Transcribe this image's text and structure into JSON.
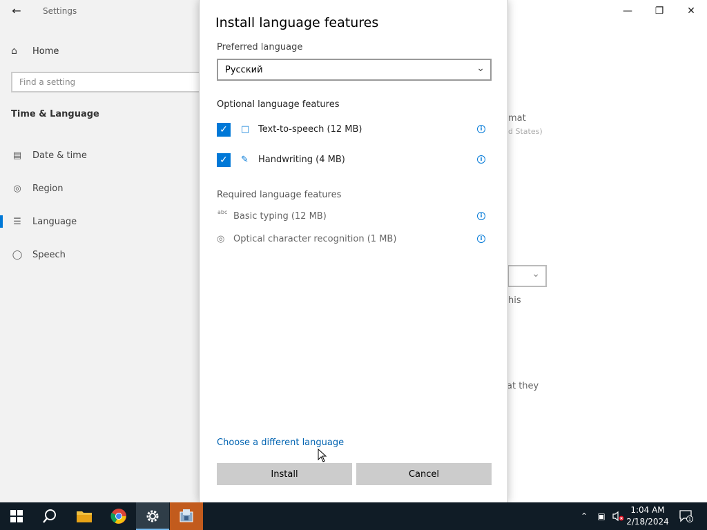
{
  "settings": {
    "app_title": "Settings",
    "home_label": "Home",
    "search_placeholder": "Find a setting",
    "section_title": "Time & Language",
    "nav": [
      {
        "label": "Date & time"
      },
      {
        "label": "Region"
      },
      {
        "label": "Language"
      },
      {
        "label": "Speech"
      }
    ],
    "background_fragments": {
      "format": "mat",
      "region": "d States)",
      "this": "his",
      "they": "at they"
    }
  },
  "dialog": {
    "title": "Install language features",
    "preferred_label": "Preferred language",
    "preferred_value": "Русский",
    "optional_label": "Optional language features",
    "optional_features": [
      {
        "label": "Text-to-speech (12 MB)",
        "checked": true
      },
      {
        "label": "Handwriting (4 MB)",
        "checked": true
      }
    ],
    "required_label": "Required language features",
    "required_features": [
      {
        "label": "Basic typing (12 MB)",
        "icon_text": "abc"
      },
      {
        "label": "Optical character recognition (1 MB)"
      }
    ],
    "link": "Choose a different language",
    "install": "Install",
    "cancel": "Cancel"
  },
  "taskbar": {
    "time": "1:04 AM",
    "date": "2/18/2024",
    "notification_count": "1"
  },
  "colors": {
    "accent": "#0078d7",
    "taskbar": "#101c26",
    "button": "#cccccc"
  }
}
